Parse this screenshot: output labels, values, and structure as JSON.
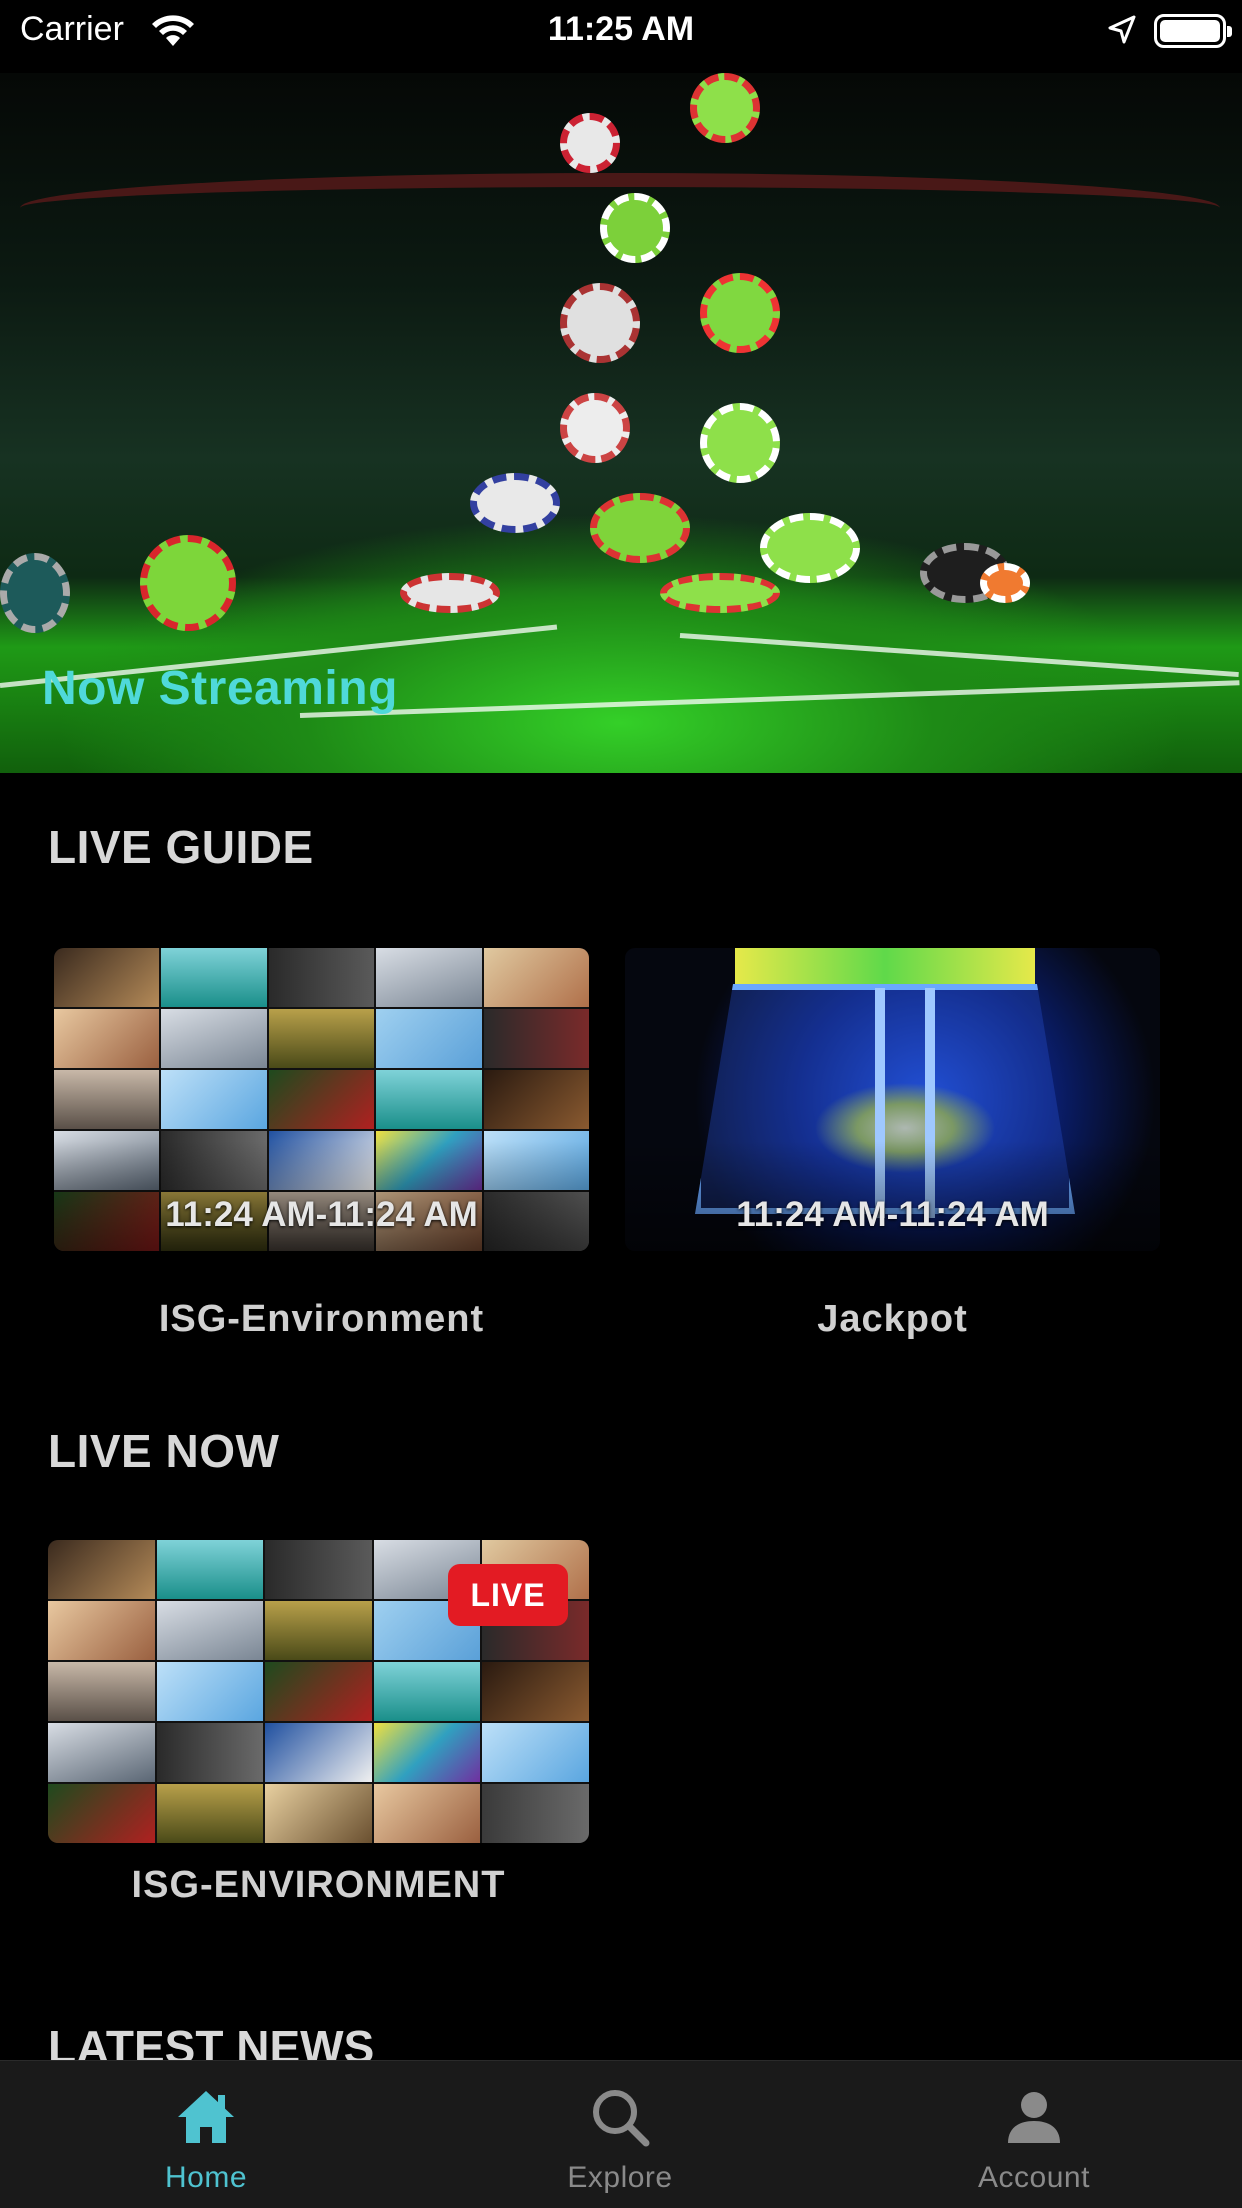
{
  "status_bar": {
    "carrier": "Carrier",
    "time": "11:25 AM",
    "wifi_icon": "wifi-icon",
    "location_icon": "location-arrow-icon",
    "battery_icon": "battery-full-icon"
  },
  "hero": {
    "title": "Now Streaming",
    "title_color": "#4fd9d9"
  },
  "live_guide": {
    "title": "LIVE GUIDE",
    "items": [
      {
        "time_range": "11:24 AM-11:24 AM",
        "name": "ISG-Environment"
      },
      {
        "time_range": "11:24 AM-11:24 AM",
        "name": "Jackpot"
      }
    ]
  },
  "live_now": {
    "title": "LIVE NOW",
    "items": [
      {
        "badge": "LIVE",
        "badge_color": "#e31b23",
        "name": "ISG-ENVIRONMENT"
      }
    ]
  },
  "latest_news": {
    "title": "LATEST NEWS"
  },
  "tab_bar": {
    "active_color": "#4fc3d0",
    "inactive_color": "#8a8a8a",
    "tabs": [
      {
        "label": "Home",
        "icon": "home-icon",
        "active": true
      },
      {
        "label": "Explore",
        "icon": "search-icon",
        "active": false
      },
      {
        "label": "Account",
        "icon": "person-icon",
        "active": false
      }
    ]
  }
}
